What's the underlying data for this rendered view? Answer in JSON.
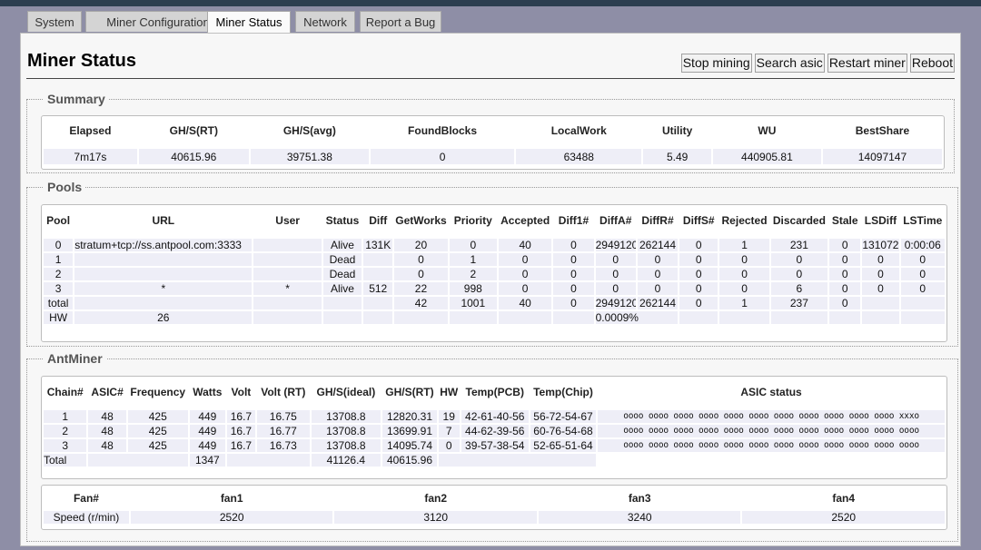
{
  "tabs": [
    "System",
    "Miner Configuration",
    "Miner Status",
    "Network",
    "Report a Bug"
  ],
  "active_tab": 2,
  "page_title": "Miner Status",
  "actions": [
    "Stop mining",
    "Search asic",
    "Restart miner",
    "Reboot"
  ],
  "summary": {
    "legend": "Summary",
    "headers": [
      "Elapsed",
      "GH/S(RT)",
      "GH/S(avg)",
      "FoundBlocks",
      "LocalWork",
      "Utility",
      "WU",
      "BestShare"
    ],
    "row": [
      "7m17s",
      "40615.96",
      "39751.38",
      "0",
      "63488",
      "5.49",
      "440905.81",
      "14097147"
    ]
  },
  "pools": {
    "legend": "Pools",
    "headers": [
      "Pool",
      "URL",
      "User",
      "Status",
      "Diff",
      "GetWorks",
      "Priority",
      "Accepted",
      "Diff1#",
      "DiffA#",
      "DiffR#",
      "DiffS#",
      "Rejected",
      "Discarded",
      "Stale",
      "LSDiff",
      "LSTime"
    ],
    "rows": [
      [
        "0",
        "stratum+tcp://ss.antpool.com:3333",
        "",
        "Alive",
        "131K",
        "20",
        "0",
        "40",
        "0",
        "2949120",
        "262144",
        "0",
        "1",
        "231",
        "0",
        "131072",
        "0:00:06"
      ],
      [
        "1",
        "",
        "",
        "Dead",
        "",
        "0",
        "1",
        "0",
        "0",
        "0",
        "0",
        "0",
        "0",
        "0",
        "0",
        "0",
        "0"
      ],
      [
        "2",
        "",
        "",
        "Dead",
        "",
        "0",
        "2",
        "0",
        "0",
        "0",
        "0",
        "0",
        "0",
        "0",
        "0",
        "0",
        "0"
      ],
      [
        "3",
        "*",
        "*",
        "Alive",
        "512",
        "22",
        "998",
        "0",
        "0",
        "0",
        "0",
        "0",
        "0",
        "6",
        "0",
        "0",
        "0"
      ],
      [
        "total",
        "",
        "",
        "",
        "",
        "42",
        "1001",
        "40",
        "0",
        "2949120",
        "262144",
        "0",
        "1",
        "237",
        "0",
        "",
        ""
      ]
    ],
    "hw_label": "HW",
    "hw_value": "26",
    "hw_percent": "0.0009%"
  },
  "antminer": {
    "legend": "AntMiner",
    "headers": [
      "Chain#",
      "ASIC#",
      "Frequency",
      "Watts",
      "Volt",
      "Volt (RT)",
      "GH/S(ideal)",
      "GH/S(RT)",
      "HW",
      "Temp(PCB)",
      "Temp(Chip)",
      "ASIC status"
    ],
    "rows": [
      [
        "1",
        "48",
        "425",
        "449",
        "16.7",
        "16.75",
        "13708.8",
        "12820.31",
        "19",
        "42-61-40-56",
        "56-72-54-67",
        "oooo oooo oooo oooo oooo oooo oooo oooo oooo oooo oooo xxxo"
      ],
      [
        "2",
        "48",
        "425",
        "449",
        "16.7",
        "16.77",
        "13708.8",
        "13699.91",
        "7",
        "44-62-39-56",
        "60-76-54-68",
        "oooo oooo oooo oooo oooo oooo oooo oooo oooo oooo oooo oooo"
      ],
      [
        "3",
        "48",
        "425",
        "449",
        "16.7",
        "16.73",
        "13708.8",
        "14095.74",
        "0",
        "39-57-38-54",
        "52-65-51-64",
        "oooo oooo oooo oooo oooo oooo oooo oooo oooo oooo oooo oooo"
      ]
    ],
    "total_label": "Total",
    "total_watts": "1347",
    "total_ideal": "41126.4",
    "total_rt": "40615.96"
  },
  "fans": {
    "headers": [
      "Fan#",
      "fan1",
      "fan2",
      "fan3",
      "fan4"
    ],
    "row_label": "Speed (r/min)",
    "values": [
      "2520",
      "3120",
      "3240",
      "2520"
    ]
  }
}
